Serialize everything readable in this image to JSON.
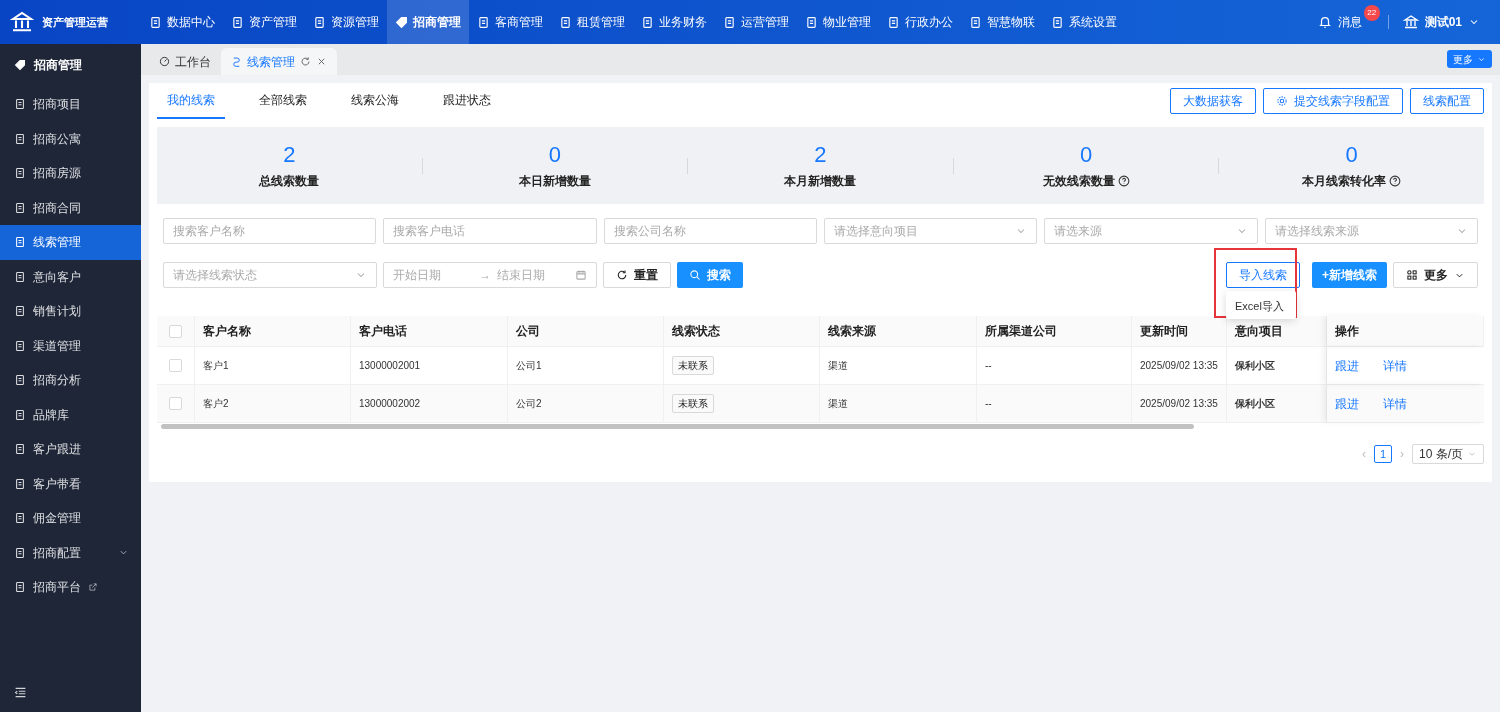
{
  "app": {
    "title": "资产管理运营"
  },
  "top_nav": [
    {
      "label": "数据中心",
      "selected": false
    },
    {
      "label": "资产管理",
      "selected": false
    },
    {
      "label": "资源管理",
      "selected": false
    },
    {
      "label": "招商管理",
      "selected": true
    },
    {
      "label": "客商管理",
      "selected": false
    },
    {
      "label": "租赁管理",
      "selected": false
    },
    {
      "label": "业务财务",
      "selected": false
    },
    {
      "label": "运营管理",
      "selected": false
    },
    {
      "label": "物业管理",
      "selected": false
    },
    {
      "label": "行政办公",
      "selected": false
    },
    {
      "label": "智慧物联",
      "selected": false
    },
    {
      "label": "系统设置",
      "selected": false
    }
  ],
  "header_right": {
    "messages": "消息",
    "badge": "22",
    "user": "测试01"
  },
  "sidebar": {
    "title": "招商管理",
    "items": [
      {
        "label": "招商项目",
        "selected": false
      },
      {
        "label": "招商公寓",
        "selected": false
      },
      {
        "label": "招商房源",
        "selected": false
      },
      {
        "label": "招商合同",
        "selected": false
      },
      {
        "label": "线索管理",
        "selected": true
      },
      {
        "label": "意向客户",
        "selected": false
      },
      {
        "label": "销售计划",
        "selected": false
      },
      {
        "label": "渠道管理",
        "selected": false
      },
      {
        "label": "招商分析",
        "selected": false
      },
      {
        "label": "品牌库",
        "selected": false
      },
      {
        "label": "客户跟进",
        "selected": false
      },
      {
        "label": "客户带看",
        "selected": false
      },
      {
        "label": "佣金管理",
        "selected": false
      },
      {
        "label": "招商配置",
        "selected": false,
        "kind": "group"
      },
      {
        "label": "招商平台",
        "selected": false,
        "kind": "external"
      }
    ]
  },
  "page_tabs": [
    {
      "label": "工作台",
      "selected": false
    },
    {
      "label": "线索管理",
      "selected": true
    }
  ],
  "more_tabs": "更多",
  "sub_tabs": [
    {
      "label": "我的线索",
      "selected": true
    },
    {
      "label": "全部线索",
      "selected": false
    },
    {
      "label": "线索公海",
      "selected": false
    },
    {
      "label": "跟进状态",
      "selected": false
    }
  ],
  "top_actions": [
    "大数据获客",
    "提交线索字段配置",
    "线索配置"
  ],
  "stats": [
    {
      "value": "2",
      "label": "总线索数量"
    },
    {
      "value": "0",
      "label": "本日新增数量"
    },
    {
      "value": "2",
      "label": "本月新增数量"
    },
    {
      "value": "0",
      "label": "无效线索数量",
      "help": true
    },
    {
      "value": "0",
      "label": "本月线索转化率",
      "help": true
    }
  ],
  "filters": [
    {
      "placeholder": "搜索客户名称",
      "kind": "input"
    },
    {
      "placeholder": "搜索客户电话",
      "kind": "input"
    },
    {
      "placeholder": "搜索公司名称",
      "kind": "input"
    },
    {
      "placeholder": "请选择意向项目",
      "kind": "select"
    },
    {
      "placeholder": "请选来源",
      "kind": "select"
    },
    {
      "placeholder": "请选择线索来源",
      "kind": "select"
    },
    {
      "placeholder": "请选择线索状态",
      "kind": "select"
    }
  ],
  "date_range": {
    "start": "开始日期",
    "separator": "→",
    "end": "结束日期"
  },
  "buttons": {
    "reset": "重置",
    "search": "搜索",
    "import": "导入线索",
    "add": "+新增线索",
    "more": "更多"
  },
  "import_menu": [
    "Excel导入"
  ],
  "table": {
    "header_checked": false,
    "columns": [
      "客户名称",
      "客户电话",
      "公司",
      "线索状态",
      "线索来源",
      "所属渠道公司",
      "更新时间",
      "意向项目",
      "操作"
    ],
    "rows": [
      {
        "checked": false,
        "cells": [
          "客户1",
          "13000002001",
          "公司1",
          "未联系",
          "渠道",
          "--",
          "2025/09/02 13:35",
          "保利小区"
        ],
        "actions": [
          "跟进",
          "详情"
        ]
      },
      {
        "checked": false,
        "cells": [
          "客户2",
          "13000002002",
          "公司2",
          "未联系",
          "渠道",
          "--",
          "2025/09/02 13:35",
          "保利小区"
        ],
        "actions": [
          "跟进",
          "详情"
        ]
      }
    ]
  },
  "pagination": {
    "prev": "‹",
    "next": "›",
    "pages": [
      {
        "label": "1",
        "selected": true
      }
    ],
    "page_size": "10 条/页"
  }
}
